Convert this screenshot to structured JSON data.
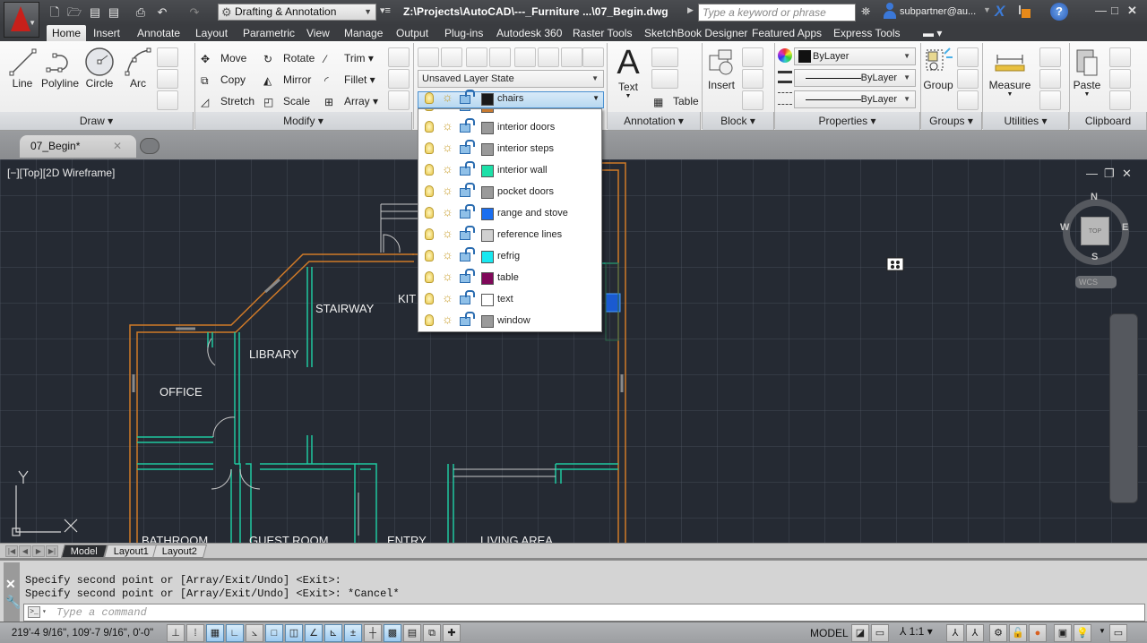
{
  "title_bar": {
    "app_menu_icon": "autocad-logo-icon",
    "quick_access": [
      "new-icon",
      "open-icon",
      "save-icon",
      "save-as-icon",
      "plot-icon",
      "undo-icon",
      "redo-icon"
    ],
    "workspace": "Drafting & Annotation",
    "document_title": "Z:\\Projects\\AutoCAD\\---_Furniture ...\\07_Begin.dwg",
    "search_placeholder": "Type a keyword or phrase",
    "user_name": "subpartner@au...",
    "window_controls": [
      "minimize",
      "restore",
      "close"
    ]
  },
  "ribbon_tabs": [
    {
      "label": "Home",
      "active": true
    },
    {
      "label": "Insert"
    },
    {
      "label": "Annotate"
    },
    {
      "label": "Layout"
    },
    {
      "label": "Parametric"
    },
    {
      "label": "View"
    },
    {
      "label": "Manage"
    },
    {
      "label": "Output"
    },
    {
      "label": "Plug-ins"
    },
    {
      "label": "Autodesk 360"
    },
    {
      "label": "Raster Tools"
    },
    {
      "label": "SketchBook Designer"
    },
    {
      "label": "Featured Apps"
    },
    {
      "label": "Express Tools"
    }
  ],
  "ribbon": {
    "draw": {
      "title": "Draw",
      "line": "Line",
      "polyline": "Polyline",
      "circle": "Circle",
      "arc": "Arc"
    },
    "modify": {
      "title": "Modify",
      "move": "Move",
      "rotate": "Rotate",
      "trim": "Trim",
      "copy": "Copy",
      "mirror": "Mirror",
      "fillet": "Fillet",
      "stretch": "Stretch",
      "scale": "Scale",
      "array": "Array"
    },
    "layers": {
      "layer_state": "Unsaved Layer State",
      "current_layer": "chairs",
      "current_color": "#1a1a1a"
    },
    "annotation": {
      "title": "Annotation",
      "text": "Text",
      "table": "Table"
    },
    "block": {
      "title": "Block",
      "insert": "Insert"
    },
    "properties": {
      "title": "Properties",
      "color": "ByLayer",
      "lineweight": "ByLayer",
      "linetype": "ByLayer"
    },
    "groups": {
      "title": "Groups",
      "group": "Group"
    },
    "utilities": {
      "title": "Utilities",
      "measure": "Measure"
    },
    "clipboard": {
      "title": "Clipboard",
      "paste": "Paste"
    }
  },
  "layer_list": [
    {
      "name": "interior doors",
      "color": "#9a9a9a"
    },
    {
      "name": "interior steps",
      "color": "#9a9a9a"
    },
    {
      "name": "interior wall",
      "color": "#1de0a8"
    },
    {
      "name": "pocket doors",
      "color": "#9a9a9a"
    },
    {
      "name": "range and stove",
      "color": "#1a6ef0"
    },
    {
      "name": "reference lines",
      "color": "#d0d0d0"
    },
    {
      "name": "refrig",
      "color": "#18e8f0"
    },
    {
      "name": "table",
      "color": "#80085a"
    },
    {
      "name": "text",
      "color": "#ffffff"
    },
    {
      "name": "window",
      "color": "#9a9a9a"
    }
  ],
  "document_tab": {
    "label": "07_Begin*"
  },
  "viewport": {
    "label": "[−][Top][2D Wireframe]",
    "viewcube": {
      "top": "TOP",
      "n": "N",
      "s": "S",
      "e": "E",
      "w": "W",
      "wcs": "WCS"
    },
    "ucs": {
      "x": "X",
      "y": "Y"
    },
    "rooms": [
      "OFFICE",
      "LIBRARY",
      "STAIRWAY",
      "KIT",
      "BATHROOM",
      "GUEST ROOM",
      "ENTRY",
      "LIVING AREA"
    ]
  },
  "layout_tabs": [
    {
      "label": "Model",
      "active": true
    },
    {
      "label": "Layout1"
    },
    {
      "label": "Layout2"
    }
  ],
  "command": {
    "history": [
      "Specify second point or [Array/Exit/Undo] <Exit>:",
      "Specify second point or [Array/Exit/Undo] <Exit>: *Cancel*"
    ],
    "placeholder": "Type a command"
  },
  "status_bar": {
    "coordinates": "219'-4 9/16\", 109'-7 9/16\", 0'-0\"",
    "space": "MODEL",
    "annotation_scale": "1:1"
  }
}
